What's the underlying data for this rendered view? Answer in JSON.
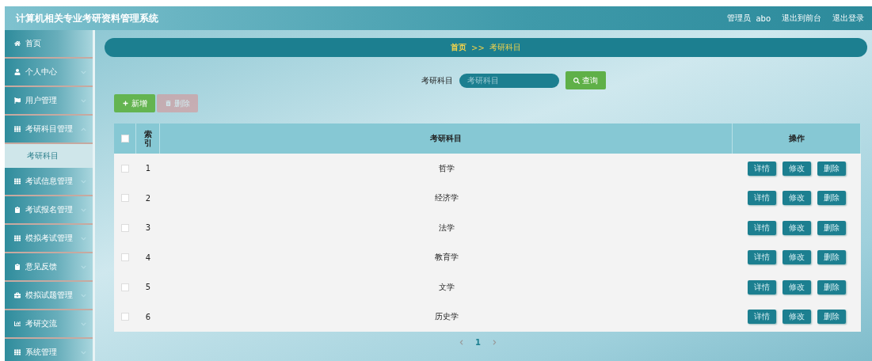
{
  "header": {
    "title": "计算机相关专业考研资料管理系统",
    "user_role": "管理员",
    "user_name": "abo",
    "links": [
      "退出到前台",
      "退出登录"
    ]
  },
  "sidebar": {
    "items": [
      {
        "label": "首页",
        "kind": "home",
        "expandable": false
      },
      {
        "label": "个人中心",
        "kind": "user",
        "expandable": true,
        "expanded": false
      },
      {
        "label": "用户管理",
        "kind": "flag",
        "expandable": true,
        "expanded": false
      },
      {
        "label": "考研科目管理",
        "kind": "grid",
        "expandable": true,
        "expanded": true,
        "children": [
          {
            "label": "考研科目",
            "selected": true
          }
        ]
      },
      {
        "label": "考试信息管理",
        "kind": "grid",
        "expandable": true,
        "expanded": false
      },
      {
        "label": "考试报名管理",
        "kind": "clipboard",
        "expandable": true,
        "expanded": false
      },
      {
        "label": "模拟考试管理",
        "kind": "grid",
        "expandable": true,
        "expanded": false
      },
      {
        "label": "意见反馈",
        "kind": "clipboard",
        "expandable": true,
        "expanded": false
      },
      {
        "label": "模拟试题管理",
        "kind": "briefcase",
        "expandable": true,
        "expanded": false
      },
      {
        "label": "考研交流",
        "kind": "chart",
        "expandable": true,
        "expanded": false
      },
      {
        "label": "系统管理",
        "kind": "grid",
        "expandable": true,
        "expanded": false
      }
    ]
  },
  "breadcrumb": {
    "home": "首页",
    "separator": ">>",
    "current": "考研科目"
  },
  "search": {
    "label": "考研科目",
    "placeholder": "考研科目",
    "button": "查询"
  },
  "actions": [
    {
      "label": "新增",
      "kind": "add",
      "disabled": false
    },
    {
      "label": "删除",
      "kind": "delete",
      "disabled": true
    }
  ],
  "table": {
    "columns": [
      "索引",
      "考研科目",
      "操作"
    ],
    "all_checked": false,
    "rows": [
      {
        "index": "1",
        "subject": "哲学",
        "checked": false,
        "buttons": [
          "详情",
          "修改",
          "删除"
        ]
      },
      {
        "index": "2",
        "subject": "经济学",
        "checked": false,
        "buttons": [
          "详情",
          "修改",
          "删除"
        ]
      },
      {
        "index": "3",
        "subject": "法学",
        "checked": false,
        "buttons": [
          "详情",
          "修改",
          "删除"
        ]
      },
      {
        "index": "4",
        "subject": "教育学",
        "checked": false,
        "buttons": [
          "详情",
          "修改",
          "删除"
        ]
      },
      {
        "index": "5",
        "subject": "文学",
        "checked": false,
        "buttons": [
          "详情",
          "修改",
          "删除"
        ]
      },
      {
        "index": "6",
        "subject": "历史学",
        "checked": false,
        "buttons": [
          "详情",
          "修改",
          "删除"
        ]
      }
    ]
  },
  "pagination": {
    "pages": [
      {
        "label": "1",
        "selected": true
      }
    ]
  }
}
